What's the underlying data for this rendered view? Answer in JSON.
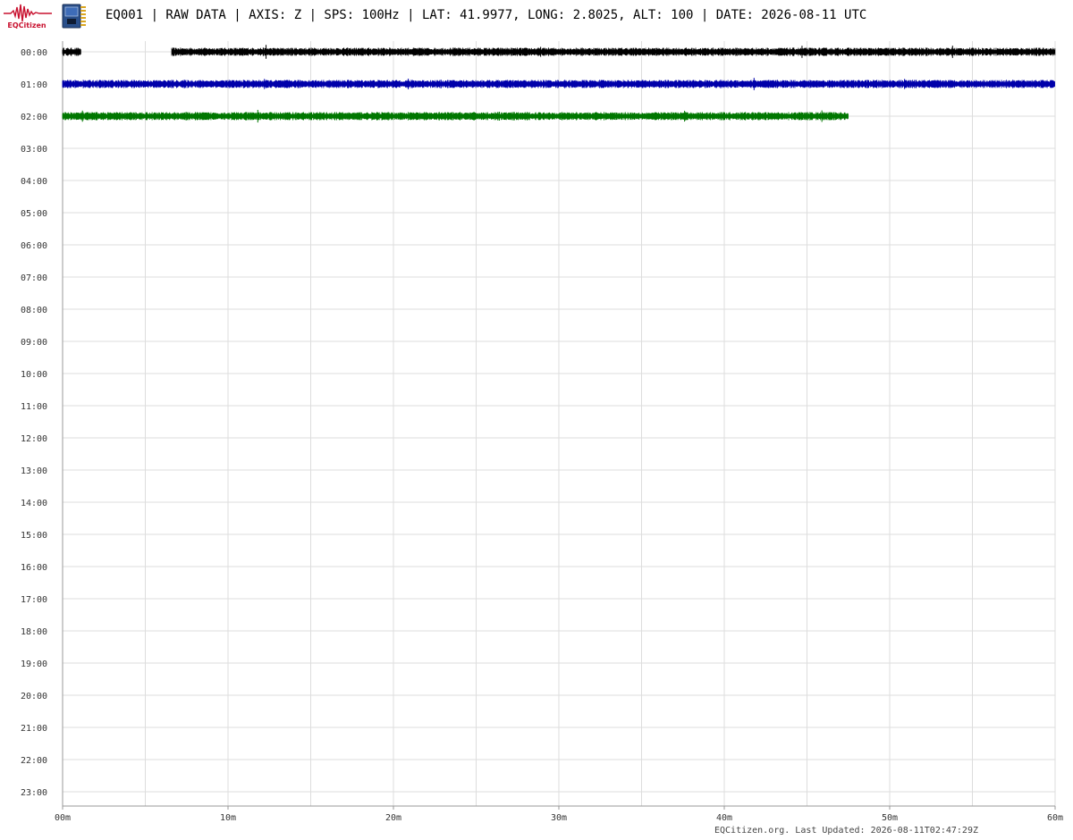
{
  "header": {
    "logo_text": "EQCitizen",
    "title": "EQ001 | RAW DATA | AXIS: Z | SPS: 100Hz | LAT: 41.9977, LONG: 2.8025, ALT: 100 | DATE: 2026-08-11 UTC"
  },
  "footer": {
    "text": "EQCitizen.org. Last Updated: 2026-08-11T02:47:29Z"
  },
  "colors": {
    "grid": "#dddddd",
    "axis": "#999999",
    "label": "#333333",
    "logo": "#c8102e"
  },
  "chart_data": {
    "type": "line",
    "title": "EQ001 | RAW DATA | AXIS: Z | SPS: 100Hz | LAT: 41.9977, LONG: 2.8025, ALT: 100 | DATE: 2026-08-11 UTC",
    "xlabel": "",
    "ylabel": "",
    "x_ticks": [
      "00m",
      "10m",
      "20m",
      "30m",
      "40m",
      "50m",
      "60m"
    ],
    "x_tick_minutes": [
      0,
      10,
      20,
      30,
      40,
      50,
      60
    ],
    "x_gridline_interval_minutes": 5,
    "xlim": [
      0,
      60
    ],
    "y_ticks": [
      "00:00",
      "01:00",
      "02:00",
      "03:00",
      "04:00",
      "05:00",
      "06:00",
      "07:00",
      "08:00",
      "09:00",
      "10:00",
      "11:00",
      "12:00",
      "13:00",
      "14:00",
      "15:00",
      "16:00",
      "17:00",
      "18:00",
      "19:00",
      "20:00",
      "21:00",
      "22:00",
      "23:00"
    ],
    "grid": true,
    "series": [
      {
        "hour": "00:00",
        "color": "#000000",
        "segments_minutes": [
          [
            0,
            1.1
          ],
          [
            6.6,
            60
          ]
        ],
        "spikes_minutes": [
          12.3,
          28.9,
          44.7,
          53.8
        ]
      },
      {
        "hour": "01:00",
        "color": "#0000aa",
        "segments_minutes": [
          [
            0,
            60
          ]
        ],
        "spikes_minutes": [
          12.2,
          20.9,
          41.8,
          50.9
        ]
      },
      {
        "hour": "02:00",
        "color": "#007700",
        "segments_minutes": [
          [
            0,
            47.5
          ]
        ],
        "spikes_minutes": [
          1.2,
          11.8,
          26.4,
          37.6,
          45.9
        ]
      }
    ]
  }
}
